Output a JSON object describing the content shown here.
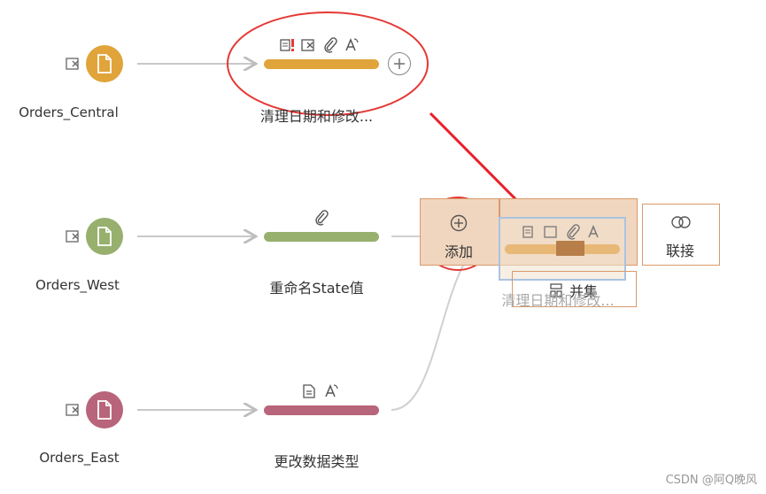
{
  "sources": [
    {
      "name": "Orders_Central",
      "color": "#e0a43a"
    },
    {
      "name": "Orders_West",
      "color": "#97b06d"
    },
    {
      "name": "Orders_East",
      "color": "#b8647a"
    }
  ],
  "steps": [
    {
      "label": "清理日期和修改...",
      "color": "#e0a43a",
      "icons": [
        "column-warning-icon",
        "remove-field-icon",
        "paperclip-icon",
        "rename-a-icon"
      ]
    },
    {
      "label": "重命名State值",
      "color": "#97b06d",
      "icons": [
        "paperclip-icon"
      ]
    },
    {
      "label": "更改数据类型",
      "color": "#b8647a",
      "icons": [
        "change-type-icon",
        "rename-a-icon"
      ]
    }
  ],
  "drop_targets": {
    "add_label": "添加",
    "union_label": "并集",
    "join_label": "联接"
  },
  "drag_ghost": {
    "label": "清理日期和修改..."
  },
  "colors": {
    "arrow_red": "#e8202a",
    "highlight_red": "#e53935",
    "drop_fill": "#f1d6bf",
    "drop_border": "#d99a6a",
    "ghost_border": "#a9c3e0"
  },
  "watermark": "CSDN @阿Q晚风"
}
